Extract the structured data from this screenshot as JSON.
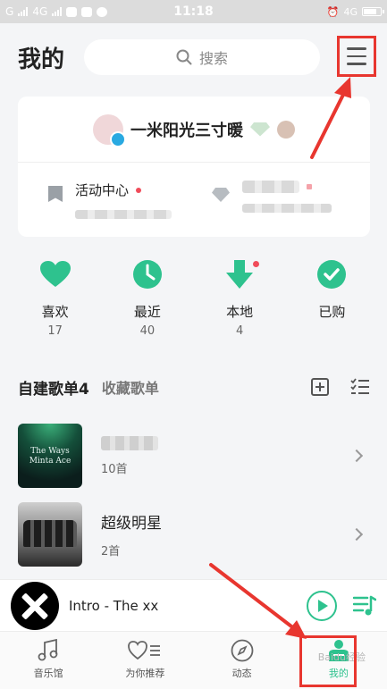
{
  "status_bar": {
    "time": "11:18",
    "left_text": "G",
    "network_left": "4G",
    "network_right": "4G"
  },
  "header": {
    "title": "我的",
    "search_placeholder": "搜索"
  },
  "profile": {
    "username": "一米阳光三寸暖",
    "left_cell_title": "活动中心"
  },
  "quick_access": [
    {
      "label": "喜欢",
      "count": "17",
      "icon": "heart-icon"
    },
    {
      "label": "最近",
      "count": "40",
      "icon": "clock-icon"
    },
    {
      "label": "本地",
      "count": "4",
      "icon": "download-icon"
    },
    {
      "label": "已购",
      "count": "",
      "icon": "check-icon"
    }
  ],
  "playlists": {
    "tab_created": "自建歌单4",
    "tab_collected": "收藏歌单",
    "items": [
      {
        "name": "",
        "count": "10首",
        "cover_text": "The Ways\nMinta Ace"
      },
      {
        "name": "超级明星",
        "count": "2首"
      }
    ]
  },
  "player": {
    "song": "Intro - The xx"
  },
  "bottom_nav": [
    {
      "label": "音乐馆",
      "icon": "music-note-icon"
    },
    {
      "label": "为你推荐",
      "icon": "heart-list-icon"
    },
    {
      "label": "动态",
      "icon": "compass-icon"
    },
    {
      "label": "我的",
      "icon": "profile-icon"
    }
  ],
  "watermark": "Baidu经验",
  "colors": {
    "accent": "#2ec28e",
    "annotation": "#e8362f",
    "dot": "#f04c5a"
  }
}
